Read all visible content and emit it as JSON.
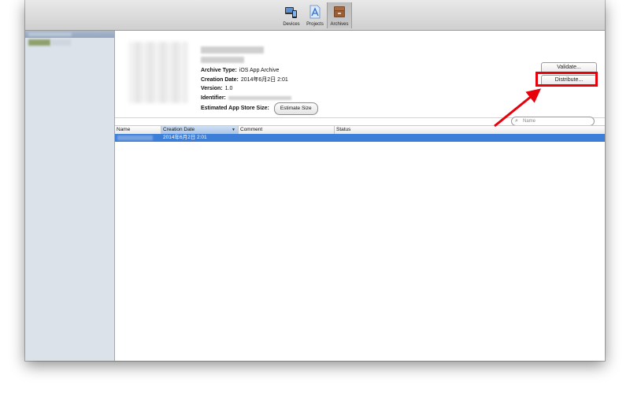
{
  "toolbar": {
    "items": [
      {
        "label": "Devices",
        "icon": "devices-icon",
        "selected": false
      },
      {
        "label": "Projects",
        "icon": "projects-icon",
        "selected": false
      },
      {
        "label": "Archives",
        "icon": "archives-icon",
        "selected": true
      }
    ]
  },
  "archive": {
    "type_label": "Archive Type:",
    "type_value": "iOS App Archive",
    "creation_label": "Creation Date:",
    "creation_value": "2014年6月2日 2:01",
    "version_label": "Version:",
    "version_value": "1.0",
    "identifier_label": "Identifier:",
    "size_label": "Estimated App Store Size:",
    "estimate_button": "Estimate Size"
  },
  "buttons": {
    "validate": "Validate...",
    "distribute": "Distribute..."
  },
  "search": {
    "placeholder": "Name"
  },
  "table": {
    "columns": [
      "Name",
      "Creation Date",
      "Comment",
      "Status"
    ],
    "rows": [
      {
        "name": "",
        "creation_date": "2014年6月2日 2:01",
        "comment": "",
        "status": ""
      }
    ]
  },
  "colors": {
    "highlight": "#e8000b",
    "selection": "#3d7fd8",
    "sidebar_bg": "#dbe2ea"
  }
}
